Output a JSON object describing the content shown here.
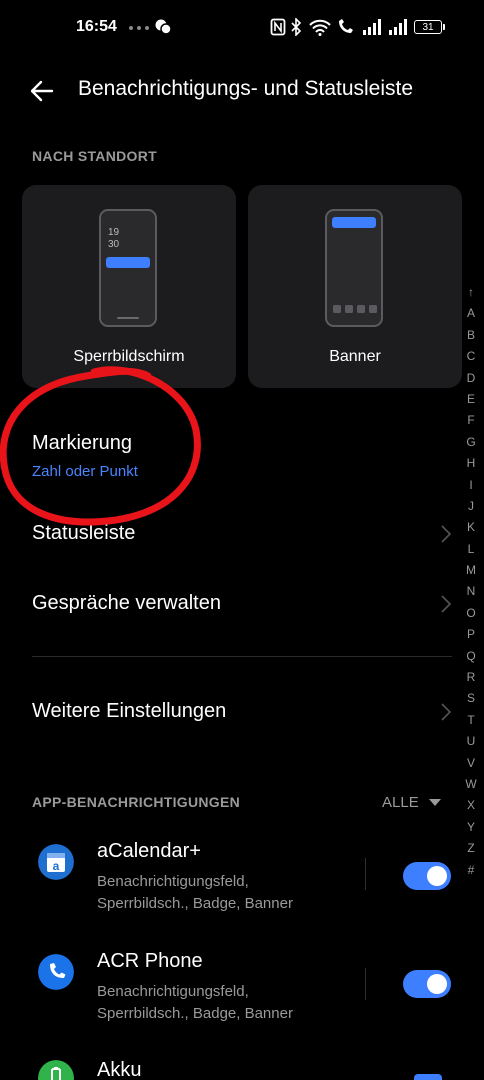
{
  "status_bar": {
    "time": "16:54",
    "battery": "31"
  },
  "header": {
    "title": "Benachrichtigungs- und Statusleiste"
  },
  "location_section": {
    "header": "NACH STANDORT",
    "lock_card": {
      "label": "Sperrbildschirm",
      "preview_time_line1": "19",
      "preview_time_line2": "30"
    },
    "banner_card": {
      "label": "Banner"
    }
  },
  "settings_rows": {
    "marking": {
      "title": "Markierung",
      "subtitle": "Zahl oder Punkt"
    },
    "statusbar": {
      "title": "Statusleiste"
    },
    "conversations": {
      "title": "Gespräche verwalten"
    },
    "more": {
      "title": "Weitere Einstellungen"
    }
  },
  "app_notifications": {
    "header": "APP-BENACHRICHTIGUNGEN",
    "filter": "ALLE",
    "apps": [
      {
        "name": "aCalendar+",
        "desc_line1": "Benachrichtigungsfeld,",
        "desc_line2": "Sperrbildsch., Badge, Banner",
        "enabled": true,
        "icon": "calendar-icon",
        "color": "#1f6fd0"
      },
      {
        "name": "ACR Phone",
        "desc_line1": "Benachrichtigungsfeld,",
        "desc_line2": "Sperrbildsch., Badge, Banner",
        "enabled": true,
        "icon": "phone-icon",
        "color": "#1a73e8"
      },
      {
        "name": "Akku",
        "icon": "battery-icon",
        "color": "#2fb34a"
      }
    ]
  },
  "alpha_index": [
    "↑",
    "A",
    "B",
    "C",
    "D",
    "E",
    "F",
    "G",
    "H",
    "I",
    "J",
    "K",
    "L",
    "M",
    "N",
    "O",
    "P",
    "Q",
    "R",
    "S",
    "T",
    "U",
    "V",
    "W",
    "X",
    "Y",
    "Z",
    "#"
  ],
  "colors": {
    "accent": "#3d7fff",
    "background": "#000000",
    "card": "#1c1c1e",
    "annotation_red": "#e8141a"
  }
}
